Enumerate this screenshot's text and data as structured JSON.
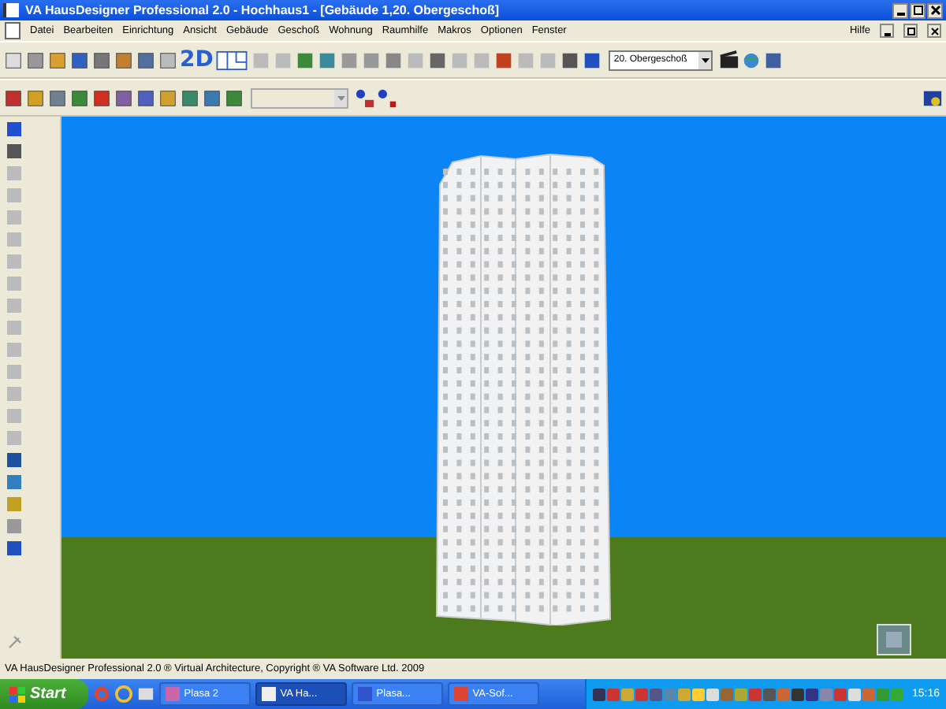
{
  "window": {
    "title": "VA HausDesigner Professional 2.0 - Hochhaus1 - [Gebäude 1,20. Obergeschoß]"
  },
  "menu": {
    "items": [
      "Datei",
      "Bearbeiten",
      "Einrichtung",
      "Ansicht",
      "Gebäude",
      "Geschoß",
      "Wohnung",
      "Raumhilfe",
      "Makros",
      "Optionen",
      "Fenster"
    ],
    "help": "Hilfe"
  },
  "toolbar": {
    "view_2d": "2D",
    "floor_select": "20. Obergeschoß"
  },
  "status_bar": {
    "text": "VA HausDesigner Professional 2.0 ® Virtual Architecture, Copyright ® VA Software Ltd. 2009"
  },
  "taskbar": {
    "start": "Start",
    "tasks": [
      {
        "label": "Plasa 2",
        "selected": false
      },
      {
        "label": "VA Ha...",
        "selected": true
      },
      {
        "label": "Plasa...",
        "selected": false
      },
      {
        "label": "VA-Sof...",
        "selected": false
      }
    ],
    "clock": "15:16"
  }
}
